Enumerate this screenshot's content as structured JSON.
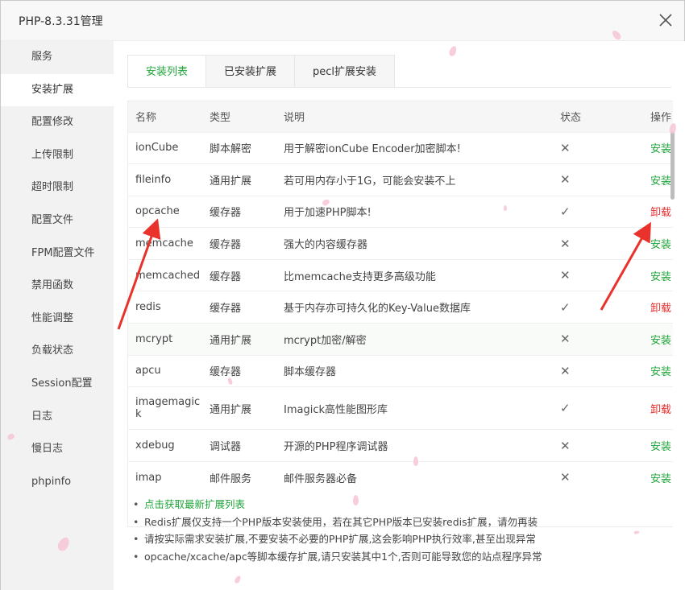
{
  "window": {
    "title": "PHP-8.3.31管理"
  },
  "sidebar": {
    "items": [
      {
        "label": "服务"
      },
      {
        "label": "安装扩展"
      },
      {
        "label": "配置修改"
      },
      {
        "label": "上传限制"
      },
      {
        "label": "超时限制"
      },
      {
        "label": "配置文件"
      },
      {
        "label": "FPM配置文件"
      },
      {
        "label": "禁用函数"
      },
      {
        "label": "性能调整"
      },
      {
        "label": "负载状态"
      },
      {
        "label": "Session配置"
      },
      {
        "label": "日志"
      },
      {
        "label": "慢日志"
      },
      {
        "label": "phpinfo"
      }
    ],
    "active_index": 1
  },
  "tabs": [
    {
      "label": "安装列表"
    },
    {
      "label": "已安装扩展"
    },
    {
      "label": "pecl扩展安装"
    }
  ],
  "table": {
    "headers": {
      "name": "名称",
      "type": "类型",
      "desc": "说明",
      "status": "状态",
      "op": "操作"
    },
    "rows": [
      {
        "name": "ionCube",
        "type": "脚本解密",
        "desc": "用于解密ionCube Encoder加密脚本!",
        "status": "✕",
        "op": "安装"
      },
      {
        "name": "fileinfo",
        "type": "通用扩展",
        "desc": "若可用内存小于1G，可能会安装不上",
        "status": "✕",
        "op": "安装"
      },
      {
        "name": "opcache",
        "type": "缓存器",
        "desc": "用于加速PHP脚本!",
        "status": "✓",
        "op": "卸载"
      },
      {
        "name": "memcache",
        "type": "缓存器",
        "desc": "强大的内容缓存器",
        "status": "✕",
        "op": "安装"
      },
      {
        "name": "memcached",
        "type": "缓存器",
        "desc": "比memcache支持更多高级功能",
        "status": "✕",
        "op": "安装"
      },
      {
        "name": "redis",
        "type": "缓存器",
        "desc": "基于内存亦可持久化的Key-Value数据库",
        "status": "✓",
        "op": "卸载"
      },
      {
        "name": "mcrypt",
        "type": "通用扩展",
        "desc": "mcrypt加密/解密",
        "status": "✕",
        "op": "安装"
      },
      {
        "name": "apcu",
        "type": "缓存器",
        "desc": "脚本缓存器",
        "status": "✕",
        "op": "安装"
      },
      {
        "name": "imagemagick",
        "type": "通用扩展",
        "desc": "Imagick高性能图形库",
        "status": "✓",
        "op": "卸载"
      },
      {
        "name": "xdebug",
        "type": "调试器",
        "desc": "开源的PHP程序调试器",
        "status": "✕",
        "op": "安装"
      },
      {
        "name": "imap",
        "type": "邮件服务",
        "desc": "邮件服务器必备",
        "status": "✕",
        "op": "安装"
      }
    ]
  },
  "notes": [
    "点击获取最新扩展列表",
    "Redis扩展仅支持一个PHP版本安装使用，若在其它PHP版本已安装redis扩展，请勿再装",
    "请按实际需求安装扩展,不要安装不必要的PHP扩展,这会影响PHP执行效率,甚至出现异常",
    "opcache/xcache/apc等脚本缓存扩展,请只安装其中1个,否则可能导致您的站点程序异常"
  ],
  "colors": {
    "accent_green": "#20a53a",
    "danger_red": "#e5302f",
    "annotation_red": "#e8322b"
  },
  "icons": {
    "close": "close-icon",
    "installed": "check-icon",
    "not_installed": "cross-icon"
  }
}
